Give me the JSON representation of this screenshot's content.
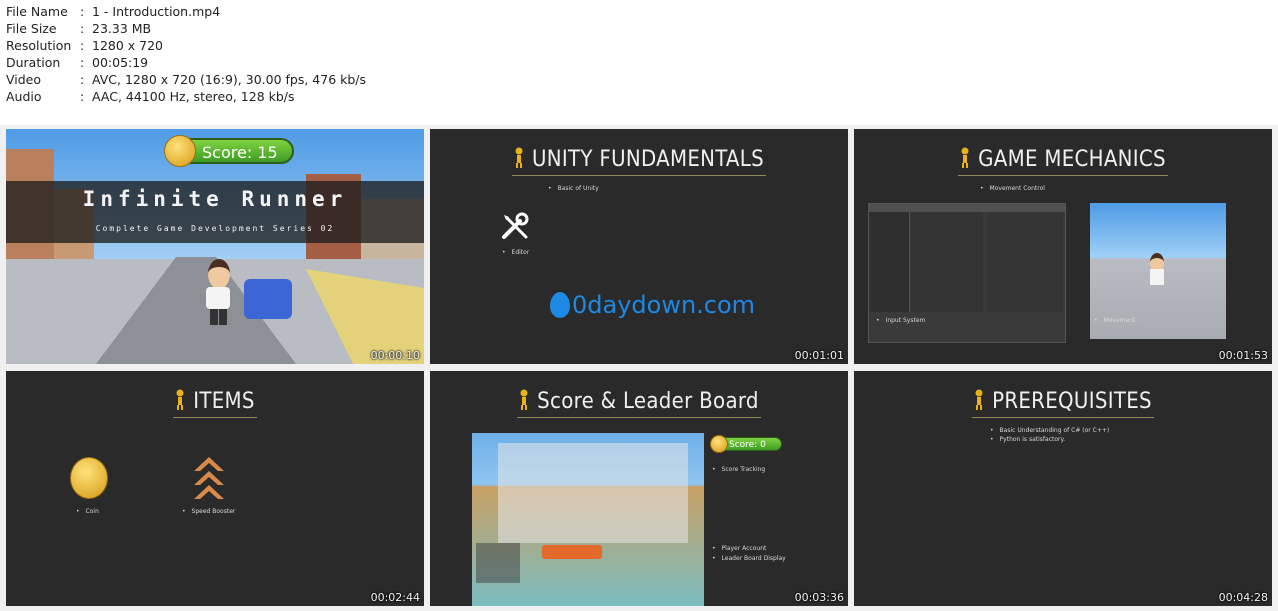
{
  "file_info": [
    {
      "key": "File Name",
      "value": "1 - Introduction.mp4"
    },
    {
      "key": "File Size",
      "value": "23.33 MB"
    },
    {
      "key": "Resolution",
      "value": "1280 x 720"
    },
    {
      "key": "Duration",
      "value": "00:05:19"
    },
    {
      "key": "Video",
      "value": "AVC, 1280 x 720 (16:9), 30.00 fps, 476 kb/s"
    },
    {
      "key": "Audio",
      "value": "AAC, 44100 Hz, stereo, 128 kb/s"
    }
  ],
  "separator": ":",
  "thumbs": {
    "t1": {
      "timestamp": "00:00:10",
      "score": "Score: 15",
      "title": "Infinite Runner",
      "subtitle": "Complete Game Development Series 02"
    },
    "t2": {
      "timestamp": "00:01:01",
      "title": "UNITY FUNDAMENTALS",
      "bullet1": "Basic of Unity",
      "bullet2": "Editor",
      "watermark": "0daydown.com"
    },
    "t3": {
      "timestamp": "00:01:53",
      "title": "GAME MECHANICS",
      "bullet1": "Movement Control",
      "bullet2": "Input System",
      "bullet3": "Movement"
    },
    "t4": {
      "timestamp": "00:02:44",
      "title": "ITEMS",
      "bullet1": "Coin",
      "bullet2": "Speed Booster"
    },
    "t5": {
      "timestamp": "00:03:36",
      "title": "Score & Leader Board",
      "score": "Score: 0",
      "bullet1": "Score Tracking",
      "bullet2": "Player Account",
      "bullet3": "Leader Board Display"
    },
    "t6": {
      "timestamp": "00:04:28",
      "title": "PREREQUISITES",
      "bullet1": "Basic Understanding of C# (or C++)",
      "bullet2": "Python is satisfactory."
    }
  },
  "colors": {
    "slide_bg": "#2a2a2a",
    "title_underline": "#8e8a55",
    "accent_yellow": "#e8b21a",
    "watermark_blue": "#1e88e5"
  }
}
